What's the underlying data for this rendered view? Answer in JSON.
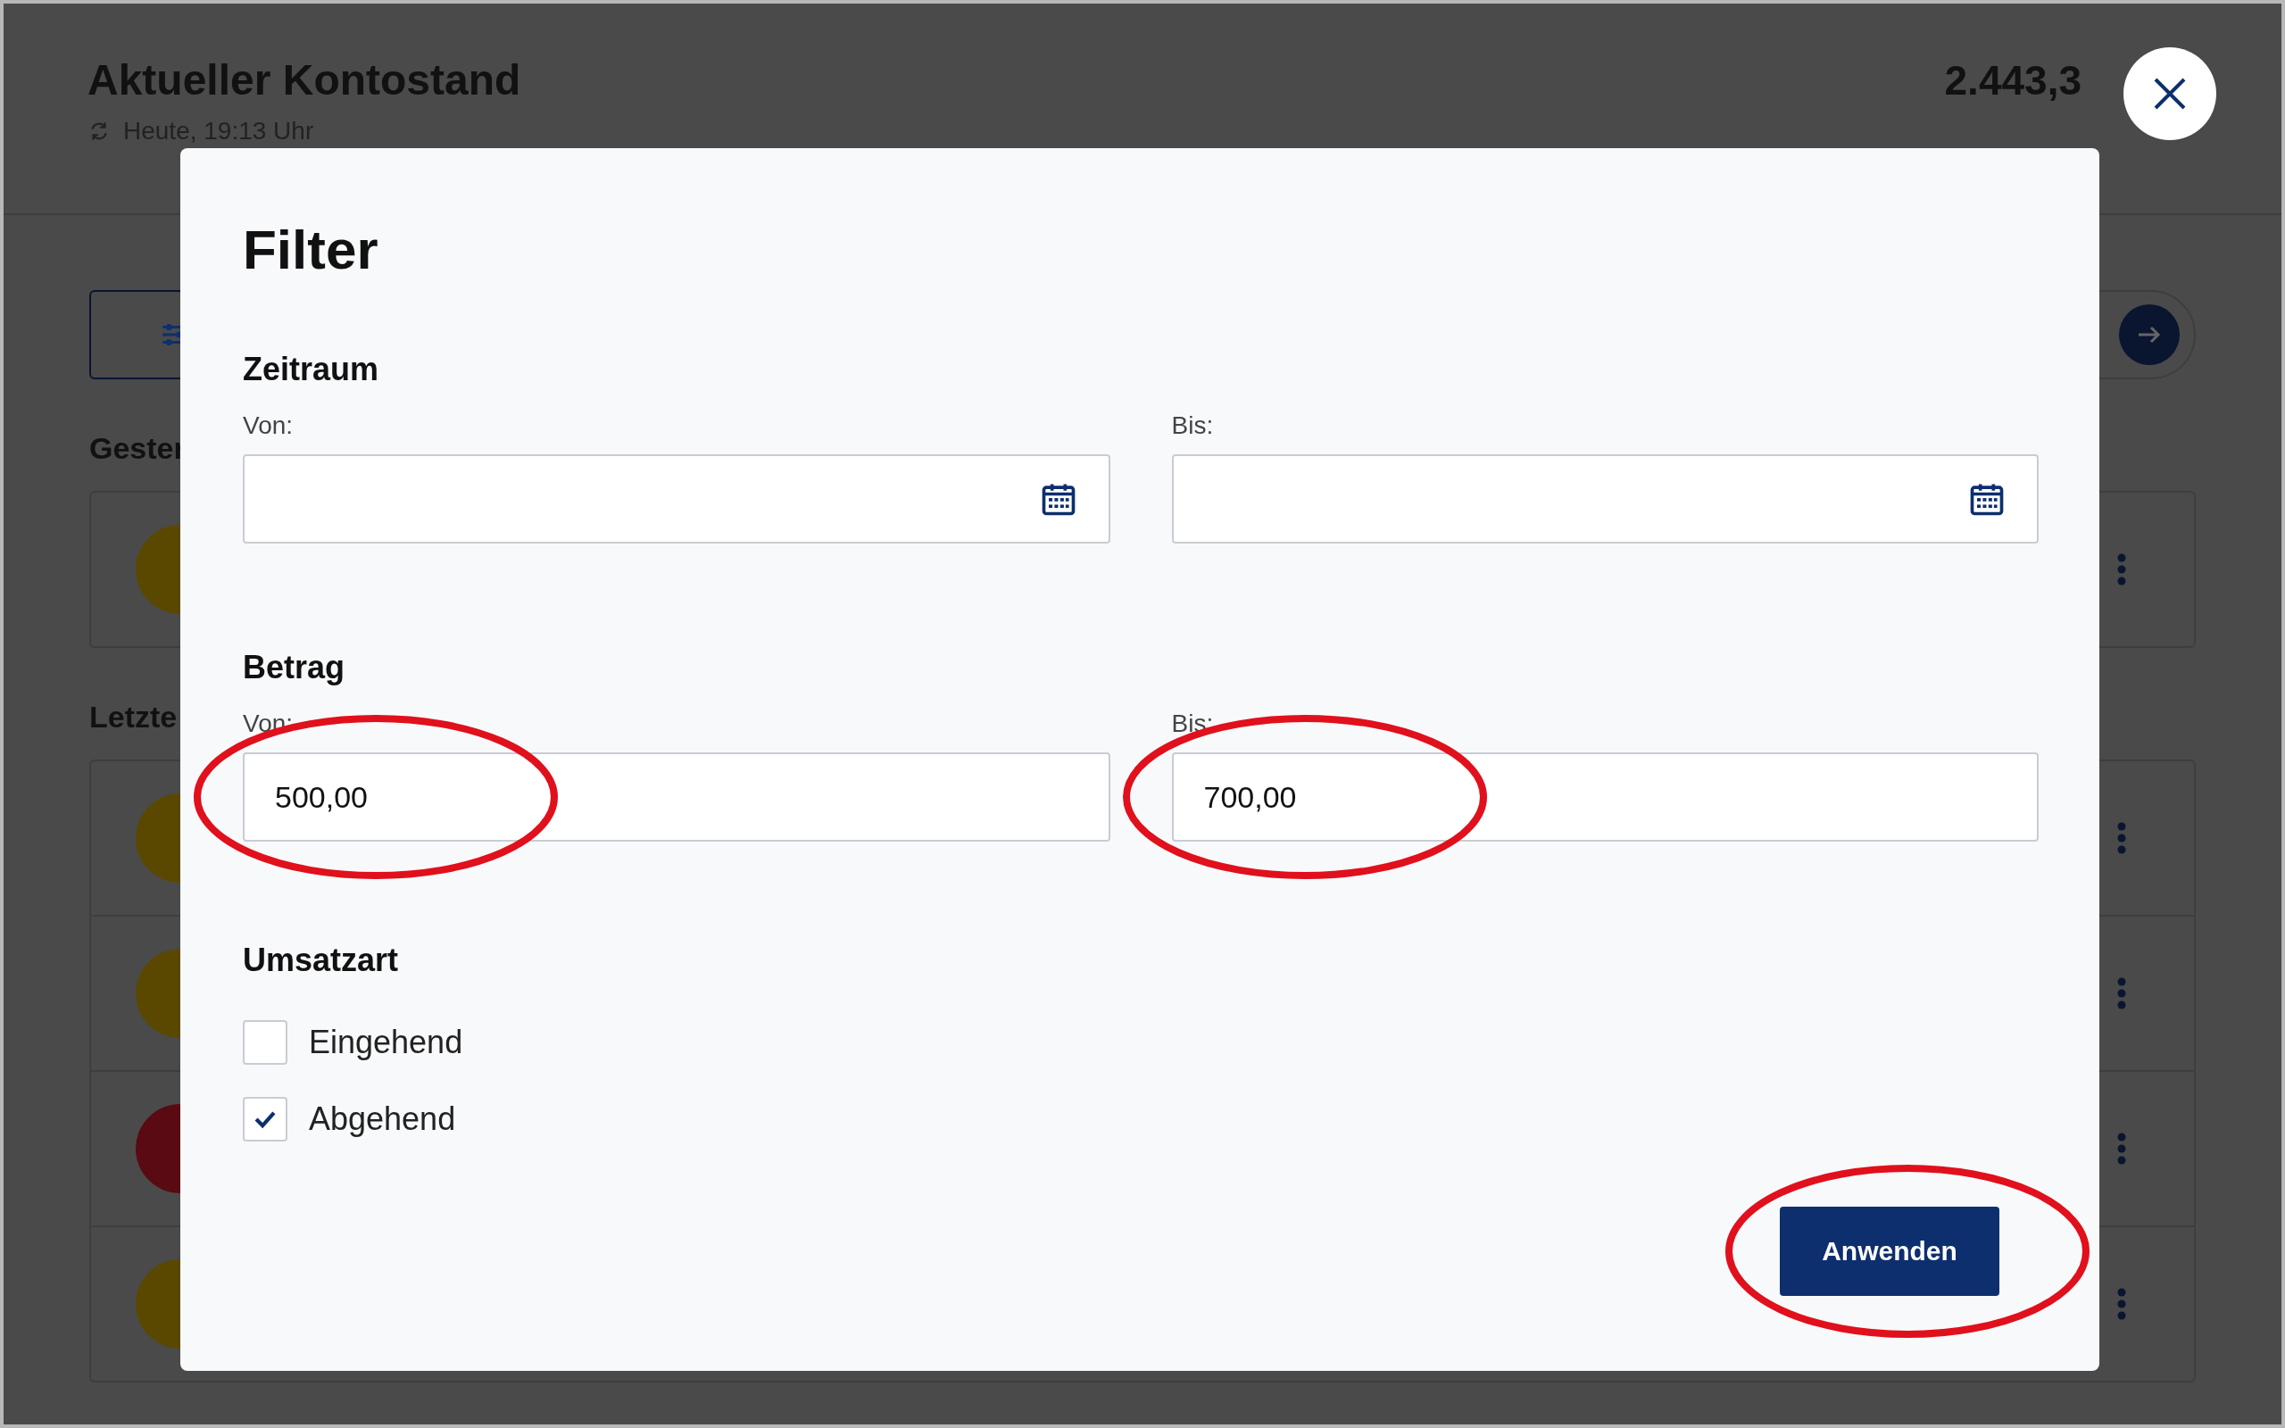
{
  "page": {
    "title": "Aktueller Kontostand",
    "updated": "Heute, 19:13 Uhr",
    "balance": "2.443,3"
  },
  "sections": [
    {
      "label": "Gester",
      "rows": [
        {
          "color": "#5a4800"
        }
      ]
    },
    {
      "label": "Letzte",
      "rows": [
        {
          "color": "#5a4800"
        },
        {
          "color": "#5a4800"
        },
        {
          "color": "#5a0a12"
        },
        {
          "color": "#5a4800"
        }
      ]
    }
  ],
  "dialog": {
    "title": "Filter",
    "groups": [
      {
        "kind": "fields",
        "heading": "Zeitraum",
        "fields": [
          {
            "kind": "date",
            "label": "Von:",
            "highlighted": false
          },
          {
            "kind": "date",
            "label": "Bis:",
            "highlighted": false
          }
        ]
      },
      {
        "kind": "fields",
        "heading": "Betrag",
        "fields": [
          {
            "kind": "amount",
            "label": "Von:",
            "value": "500,00",
            "highlighted": true
          },
          {
            "kind": "amount",
            "label": "Bis:",
            "value": "700,00",
            "highlighted": true
          }
        ]
      },
      {
        "kind": "checks",
        "heading": "Umsatzart",
        "options": [
          {
            "label": "Eingehend",
            "checked": false
          },
          {
            "label": "Abgehend",
            "checked": true
          }
        ]
      }
    ],
    "apply_button": {
      "label": "Anwenden",
      "highlighted": true
    }
  }
}
